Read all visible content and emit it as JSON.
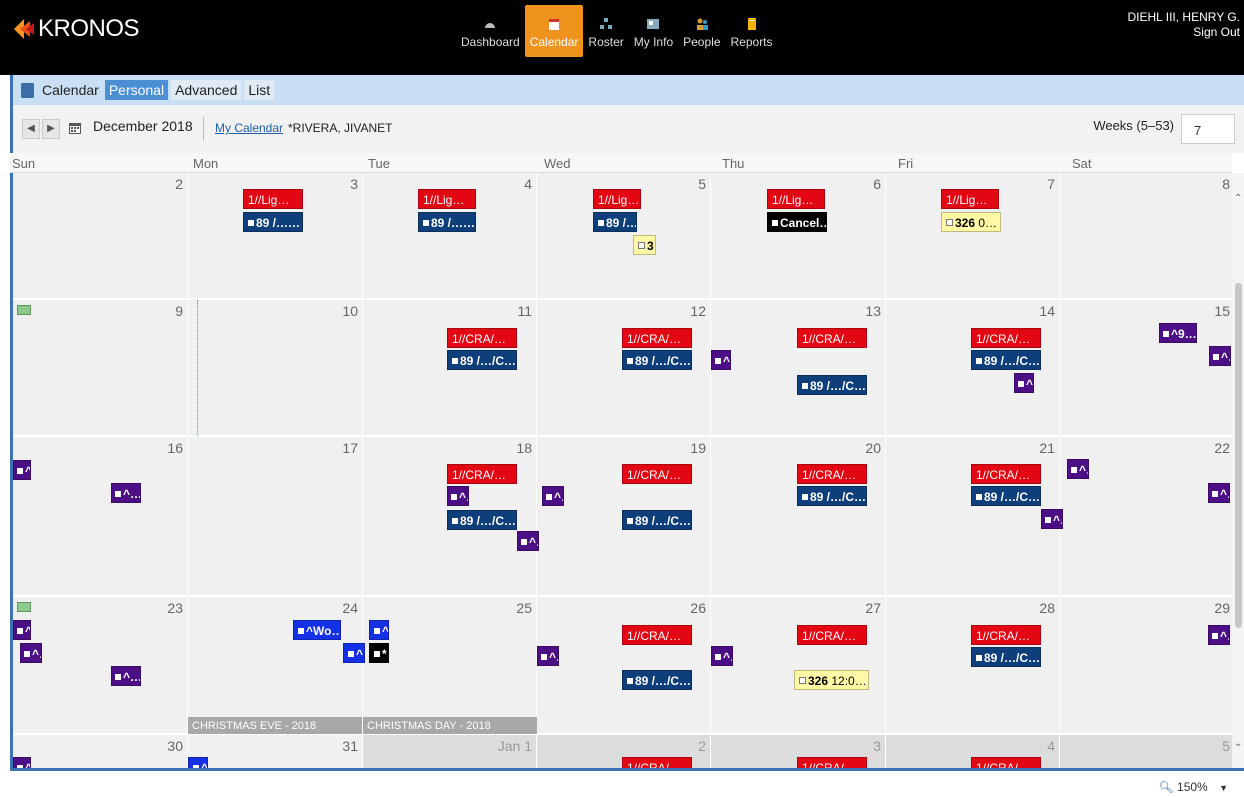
{
  "header": {
    "brand": "KRONOS",
    "nav": [
      {
        "label": "Dashboard",
        "icon": "dashboard-icon",
        "active": false
      },
      {
        "label": "Calendar",
        "icon": "calendar-icon",
        "active": true
      },
      {
        "label": "Roster",
        "icon": "roster-icon",
        "active": false
      },
      {
        "label": "My Info",
        "icon": "my-info-icon",
        "active": false
      },
      {
        "label": "People",
        "icon": "people-icon",
        "active": false
      },
      {
        "label": "Reports",
        "icon": "reports-icon",
        "active": false
      }
    ],
    "user_name": "DIEHL III, HENRY G.",
    "sign_out": "Sign Out"
  },
  "tabs": {
    "title": "Calendar",
    "items": [
      "Personal",
      "Advanced",
      "List"
    ],
    "active": "Personal"
  },
  "toolbar": {
    "month": "December 2018",
    "my_calendar": "My Calendar",
    "person": "*RIVERA, JIVANET",
    "weeks_label": "Weeks (5–53)",
    "weeks_value": "7"
  },
  "days": [
    "Sun",
    "Mon",
    "Tue",
    "Wed",
    "Thu",
    "Fri",
    "Sat"
  ],
  "weeks": [
    {
      "dates": [
        "2",
        "3",
        "4",
        "5",
        "6",
        "7",
        "8"
      ]
    },
    {
      "dates": [
        "9",
        "10",
        "11",
        "12",
        "13",
        "14",
        "15"
      ]
    },
    {
      "dates": [
        "16",
        "17",
        "18",
        "19",
        "20",
        "21",
        "22"
      ]
    },
    {
      "dates": [
        "23",
        "24",
        "25",
        "26",
        "27",
        "28",
        "29"
      ]
    },
    {
      "dates": [
        "30",
        "31",
        "Jan 1",
        "2",
        "3",
        "4",
        "5"
      ]
    }
  ],
  "events": {
    "w1_mon_red": "1//Lig…",
    "w1_mon_blue": "89 /……",
    "w1_tue_red": "1//Lig…",
    "w1_tue_blue": "89 /……",
    "w1_wed_red": "1//Lig…",
    "w1_wed_blue": "89 /…",
    "w1_wed_yellow": "3",
    "w1_thu_red": "1//Lig…",
    "w1_thu_black": "Cancel…",
    "w1_fri_red": "1//Lig…",
    "w1_fri_yellow_bold": "326",
    "w1_fri_yellow_rest": " 0…",
    "cra": "1//CRA/…",
    "c89": "89 /…/C…",
    "caret": "^…",
    "caret9": "^9…",
    "wo": "^Wo…",
    "star": "*",
    "y326_bold": "326",
    "y326_rest": " 12:0…",
    "cra_partial": "1//CRA/…"
  },
  "holidays": {
    "christmas_eve": "CHRISTMAS EVE - 2018",
    "christmas_day": "CHRISTMAS DAY - 2018"
  },
  "status": {
    "zoom": "150%"
  }
}
